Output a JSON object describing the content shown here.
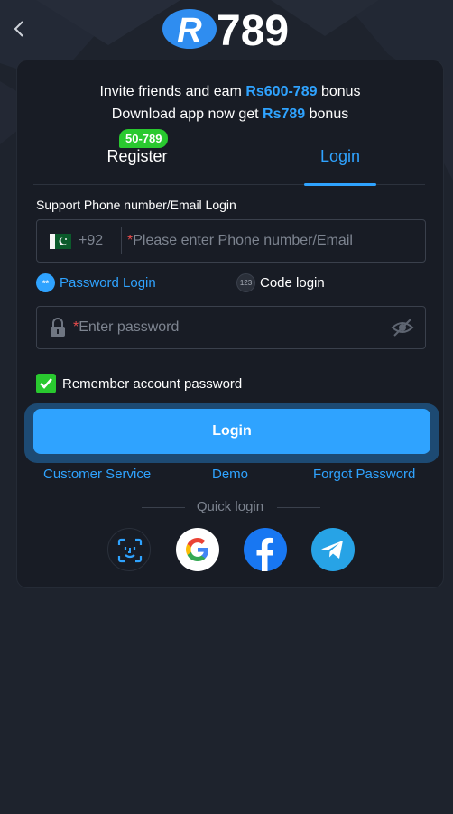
{
  "header": {
    "logo_text": "R789",
    "logo_letter": "R",
    "logo_digits": "789",
    "back_icon": "chevron-left-icon"
  },
  "promo": {
    "line1_prefix": "Invite friends and eam ",
    "line1_amount": "Rs600-789",
    "line1_suffix": " bonus",
    "line2_prefix": "Download app now get ",
    "line2_amount": "Rs789",
    "line2_suffix": " bonus"
  },
  "tabs": {
    "register_label": "Register",
    "register_badge": "50-789",
    "login_label": "Login",
    "active": "Login"
  },
  "form": {
    "support_label": "Support Phone number/Email Login",
    "country_code": "+92",
    "required_mark": "*",
    "phone_placeholder": "Please enter Phone number/Email",
    "password_mode_label": "Password Login",
    "password_mode_icon_text": "**",
    "code_mode_label": "Code login",
    "code_mode_icon_text": "123",
    "password_placeholder": "Enter password",
    "remember_label": "Remember account password",
    "remember_checked": true,
    "login_button": "Login"
  },
  "links": {
    "customer_service": "Customer Service",
    "demo": "Demo",
    "forgot_password": "Forgot Password"
  },
  "quick_login": {
    "label": "Quick login",
    "providers": [
      "face-id-icon",
      "google-icon",
      "facebook-icon",
      "telegram-icon"
    ]
  },
  "colors": {
    "accent": "#2fa3ff",
    "background": "#1e232d",
    "card": "#181c25",
    "badge_green": "#29c92f",
    "required_red": "#e84c4c"
  }
}
